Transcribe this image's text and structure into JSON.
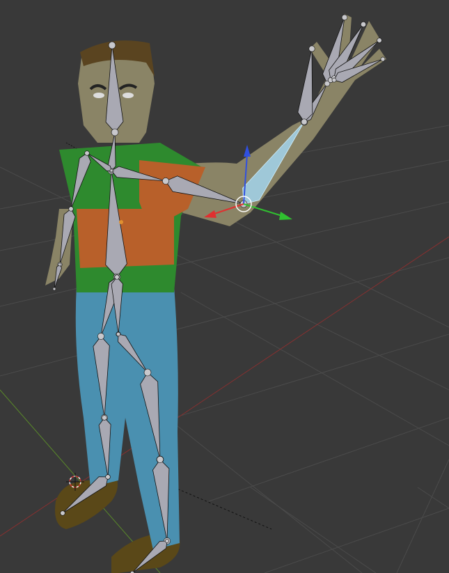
{
  "viewport": {
    "mode": "Pose Mode",
    "selected_bone": "forearm",
    "colors": {
      "background": "#393939",
      "grid": "#4b4b4b",
      "x_axis": "#8a3030",
      "y_axis": "#5a8a2a",
      "bone_fill": "#a9a9b3",
      "bone_selected": "#9fc8d8",
      "bone_outline": "#111111",
      "gizmo_x": "#e03030",
      "gizmo_y": "#30c030",
      "gizmo_z": "#3050e0",
      "skin": "#8a8466",
      "hair": "#5a4420",
      "shirt_green": "#2e8a2e",
      "shirt_orange": "#b8602a",
      "jeans": "#4a90b0",
      "shoes": "#5a4818"
    }
  }
}
